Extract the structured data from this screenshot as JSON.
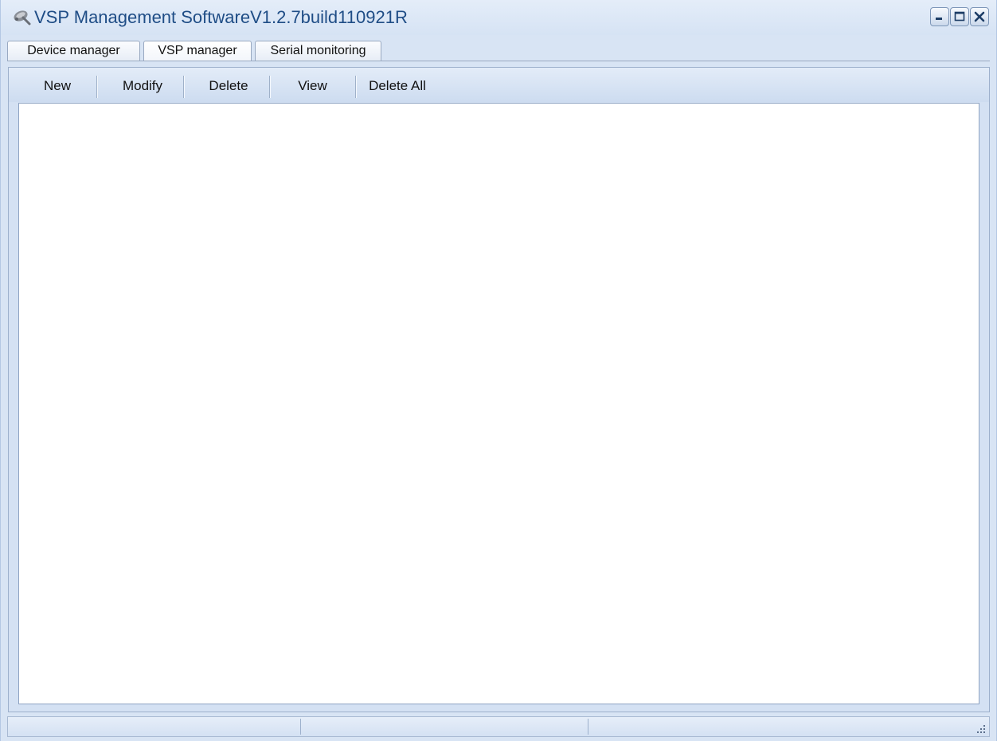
{
  "window": {
    "title": "VSP Management SoftwareV1.2.7build110921R",
    "controls": [
      "minimize-icon",
      "maximize-icon",
      "close-icon"
    ]
  },
  "tabs": [
    {
      "label": "Device manager"
    },
    {
      "label": "VSP manager",
      "active": true
    },
    {
      "label": "Serial monitoring"
    }
  ],
  "toolbar": {
    "new_label": "New",
    "modify_label": "Modify",
    "delete_label": "Delete",
    "view_label": "View",
    "delete_all_label": "Delete All"
  },
  "statusbar": {
    "panes": [
      "",
      "",
      ""
    ]
  },
  "colors": {
    "title_text": "#1f4d86",
    "frame_background": "#d8e4f4",
    "content_background": "#ffffff"
  }
}
